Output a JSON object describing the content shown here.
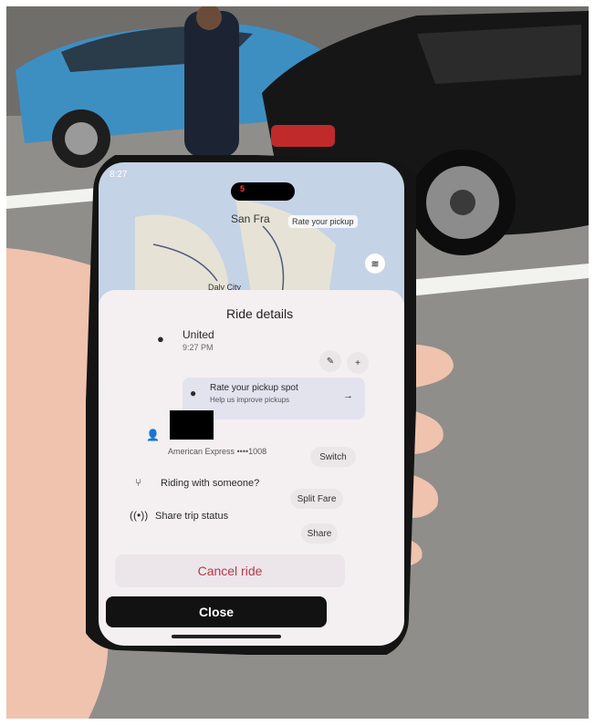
{
  "colors": {
    "map_water": "#c5d3e6",
    "sheet_bg": "#f4eff1",
    "cancel_text": "#b43a4a",
    "close_bg": "#121212",
    "car_blue": "#3d8fc2"
  },
  "status": {
    "time": "8:27",
    "badge": "5"
  },
  "map": {
    "pickup_label": "Rate your pickup",
    "city1": "San Fra",
    "city2": "Daly City"
  },
  "sheet": {
    "title": "Ride details",
    "destination": {
      "name": "United",
      "time": "9:27 PM",
      "icon": "location-pin-icon"
    },
    "rate_pickup": {
      "title": "Rate your pickup spot",
      "subtitle": "Help us improve pickups",
      "arrow": "→"
    },
    "payment": {
      "card": "American Express ••••1008",
      "action": "Switch",
      "icon": "person-icon"
    },
    "split": {
      "label": "Riding with someone?",
      "action": "Split Fare",
      "icon": "split-icon"
    },
    "share": {
      "label": "Share trip status",
      "action": "Share",
      "icon": "broadcast-icon"
    },
    "cancel_label": "Cancel ride",
    "close_label": "Close",
    "edit_icon": "pencil-icon",
    "add_icon": "plus-icon"
  }
}
